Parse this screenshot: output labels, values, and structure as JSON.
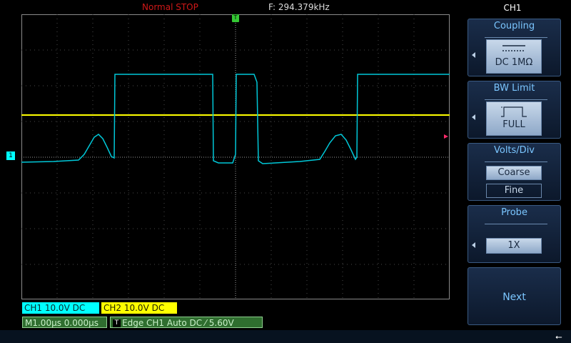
{
  "status": {
    "mode": "Normal  STOP",
    "frequency": "F: 294.379kHz"
  },
  "markers": {
    "trigger_top": "T",
    "ch1_ground": "1"
  },
  "channel_info": {
    "ch1": "CH1  10.0V  DC",
    "ch2": "CH2  10.0V  DC",
    "timebase": "M1.00µs  0.000µs",
    "trigger_icon": "T",
    "trigger": "Edge  CH1  Auto  DC ⁄  5.60V"
  },
  "menu": {
    "title": "CH1",
    "coupling": {
      "label": "Coupling",
      "value": "DC 1MΩ"
    },
    "bw_limit": {
      "label": "BW Limit",
      "value": "FULL"
    },
    "volts_div": {
      "label": "Volts/Div",
      "options": [
        "Coarse",
        "Fine"
      ],
      "selected": "Coarse"
    },
    "probe": {
      "label": "Probe",
      "value": "1X"
    },
    "next": "Next"
  },
  "colors": {
    "ch1": "#00ffff",
    "ch2": "#ffff00",
    "grid": "#8a8a8a",
    "stop": "#d01818",
    "menu_title": "#7bc6ff"
  }
}
